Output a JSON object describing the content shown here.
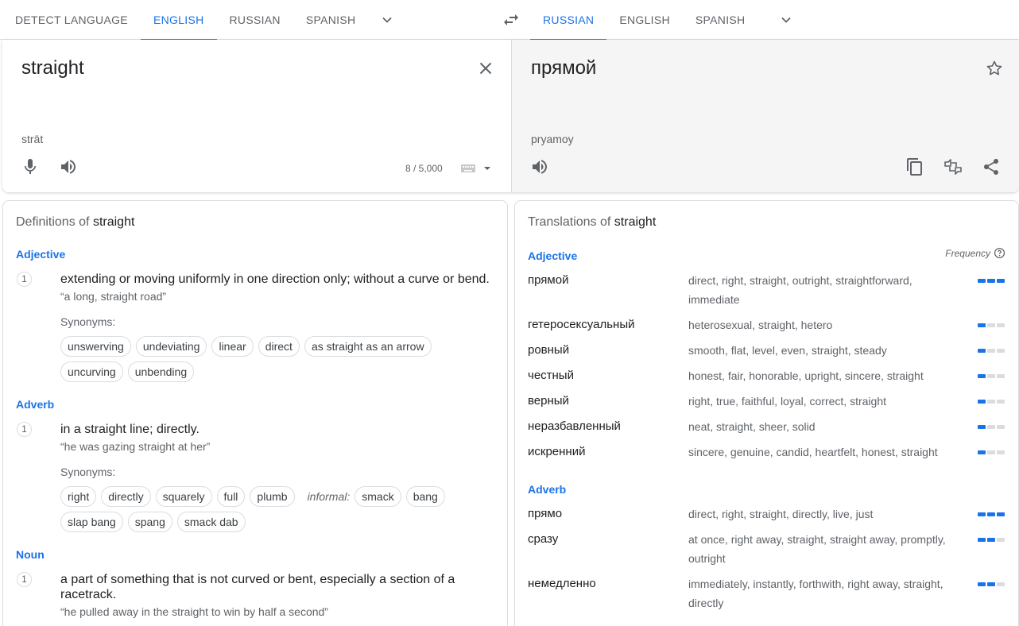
{
  "source_tabs": [
    "DETECT LANGUAGE",
    "ENGLISH",
    "RUSSIAN",
    "SPANISH"
  ],
  "target_tabs": [
    "RUSSIAN",
    "ENGLISH",
    "SPANISH"
  ],
  "source": {
    "text": "straight",
    "transliteration": "strāt",
    "char_count": "8 / 5,000"
  },
  "target": {
    "text": "прямой",
    "transliteration": "pryamoy"
  },
  "definitions": {
    "title_prefix": "Definitions of ",
    "word": "straight",
    "synonyms_label": "Synonyms:",
    "informal_label": "informal:",
    "sections": [
      {
        "pos": "Adjective",
        "num": "1",
        "gloss": "extending or moving uniformly in one direction only; without a curve or bend.",
        "example": "“a long, straight road”",
        "chips_row1": [
          "unswerving",
          "undeviating",
          "linear",
          "direct",
          "as straight as an arrow"
        ],
        "chips_row2": [
          "uncurving",
          "unbending"
        ]
      },
      {
        "pos": "Adverb",
        "num": "1",
        "gloss": "in a straight line; directly.",
        "example": "“he was gazing straight at her”",
        "chips_row1": [
          "right",
          "directly",
          "squarely",
          "full",
          "plumb"
        ],
        "chips_row1_informal": [
          "smack",
          "bang"
        ],
        "chips_row2": [
          "slap bang",
          "spang",
          "smack dab"
        ]
      },
      {
        "pos": "Noun",
        "num": "1",
        "gloss": "a part of something that is not curved or bent, especially a section of a racetrack.",
        "example": "“he pulled away in the straight to win by half a second”"
      }
    ]
  },
  "translations": {
    "title_prefix": "Translations of ",
    "word": "straight",
    "frequency_label": "Frequency",
    "groups": [
      {
        "pos": "Adjective",
        "rows": [
          {
            "word": "прямой",
            "synonyms": "direct, right, straight, outright, straightforward, immediate",
            "freq": 3
          },
          {
            "word": "гетеросексуальный",
            "synonyms": "heterosexual, straight, hetero",
            "freq": 1
          },
          {
            "word": "ровный",
            "synonyms": "smooth, flat, level, even, straight, steady",
            "freq": 1
          },
          {
            "word": "честный",
            "synonyms": "honest, fair, honorable, upright, sincere, straight",
            "freq": 1
          },
          {
            "word": "верный",
            "synonyms": "right, true, faithful, loyal, correct, straight",
            "freq": 1
          },
          {
            "word": "неразбавленный",
            "synonyms": "neat, straight, sheer, solid",
            "freq": 1
          },
          {
            "word": "искренний",
            "synonyms": "sincere, genuine, candid, heartfelt, honest, straight",
            "freq": 1
          }
        ]
      },
      {
        "pos": "Adverb",
        "rows": [
          {
            "word": "прямо",
            "synonyms": "direct, right, straight, directly, live, just",
            "freq": 3
          },
          {
            "word": "сразу",
            "synonyms": "at once, right away, straight, straight away, promptly, outright",
            "freq": 2
          },
          {
            "word": "немедленно",
            "synonyms": "immediately, instantly, forthwith, right away, straight, directly",
            "freq": 2
          }
        ]
      }
    ]
  },
  "colors": {
    "accent": "#1a73e8",
    "text_primary": "#202124",
    "text_secondary": "#5f6368",
    "target_panel_bg": "#f5f5f5"
  },
  "icons": [
    "chevron-down-icon",
    "swap-languages-icon",
    "close-icon",
    "microphone-icon",
    "speaker-icon",
    "keyboard-icon",
    "star-icon",
    "copy-icon",
    "feedback-icon",
    "share-icon",
    "help-icon"
  ]
}
